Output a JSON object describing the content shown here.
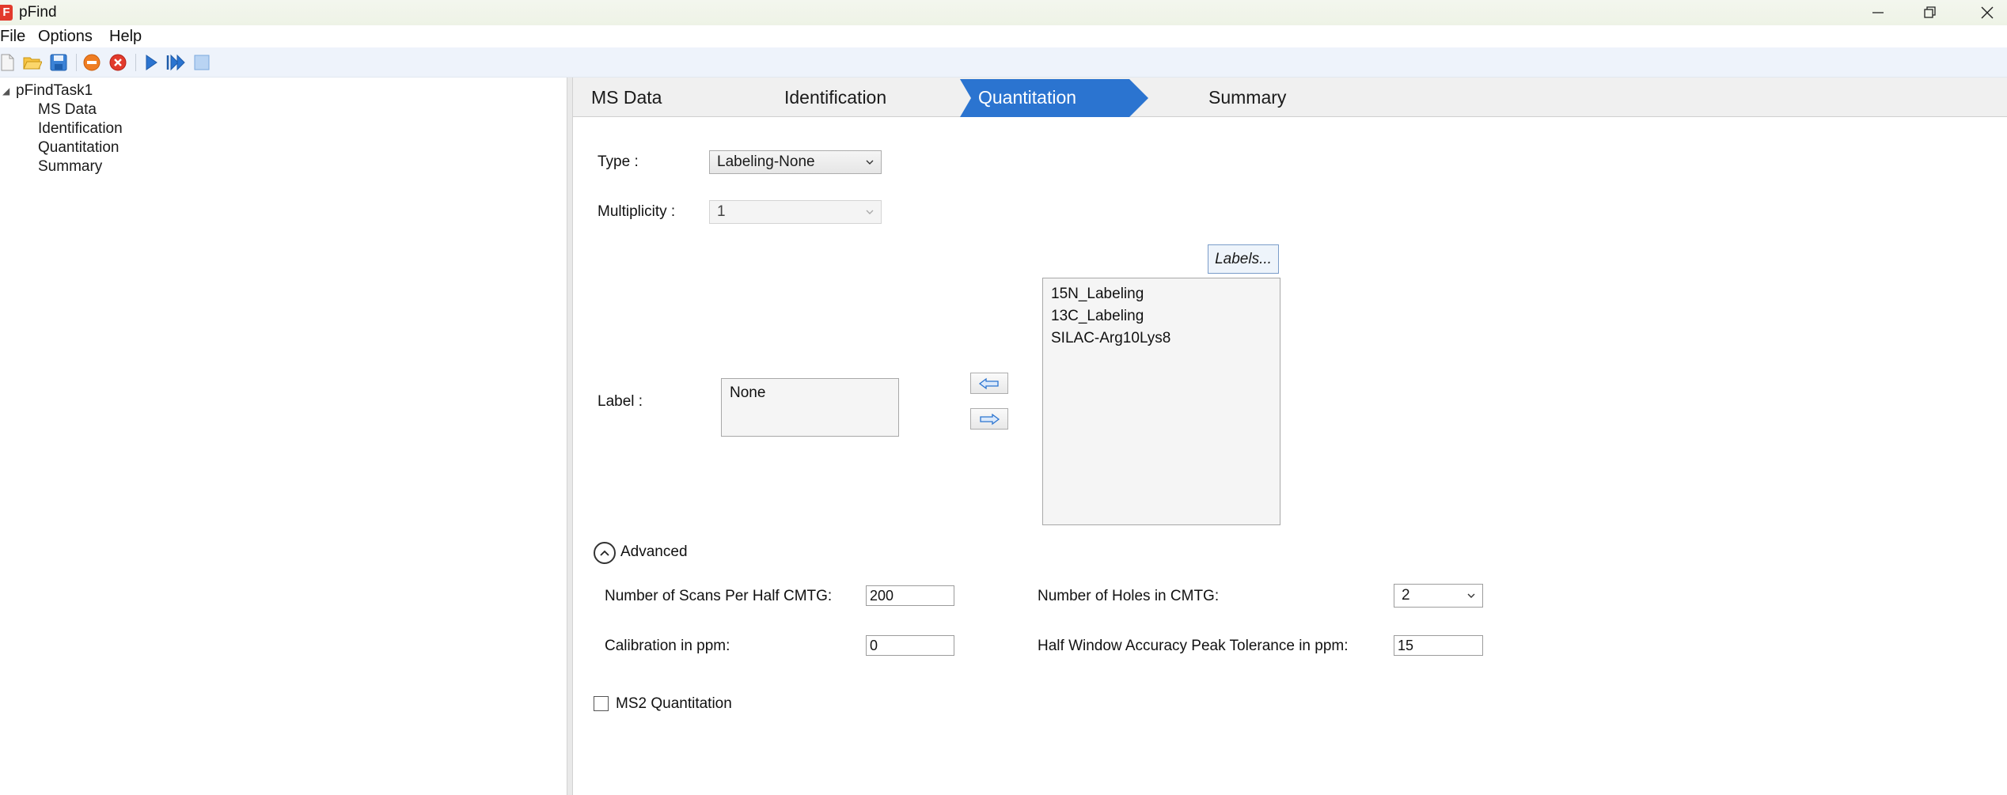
{
  "window": {
    "title": "pFind",
    "logo_letter": "F"
  },
  "menu": [
    "File",
    "Options",
    "Help"
  ],
  "toolbar": {
    "icons": [
      "new-file-icon",
      "open-folder-icon",
      "save-icon",
      "stop-icon",
      "cancel-icon",
      "run-icon",
      "run-all-icon",
      "stop-square-icon"
    ]
  },
  "tree": {
    "root": "pFindTask1",
    "children": [
      "MS Data",
      "Identification",
      "Quantitation",
      "Summary"
    ]
  },
  "steps": {
    "tabs": [
      "MS Data",
      "Identification",
      "Quantitation",
      "Summary"
    ],
    "active": "Quantitation",
    "active_color": "#2b74d0"
  },
  "form": {
    "type_label": "Type :",
    "type_value": "Labeling-None",
    "multiplicity_label": "Multiplicity :",
    "multiplicity_value": "1",
    "label_label": "Label :",
    "selected_labels": [
      "None"
    ],
    "labels_button": "Labels...",
    "available_labels": [
      "15N_Labeling",
      "13C_Labeling",
      "SILAC-Arg10Lys8"
    ]
  },
  "advanced": {
    "title": "Advanced",
    "scans_label": "Number of Scans Per Half CMTG:",
    "scans_value": "200",
    "holes_label": "Number of Holes in CMTG:",
    "holes_value": "2",
    "calibration_label": "Calibration in ppm:",
    "calibration_value": "0",
    "tolerance_label": "Half Window Accuracy Peak Tolerance in ppm:",
    "tolerance_value": "15"
  },
  "ms2": {
    "label": "MS2 Quantitation",
    "checked": false
  }
}
